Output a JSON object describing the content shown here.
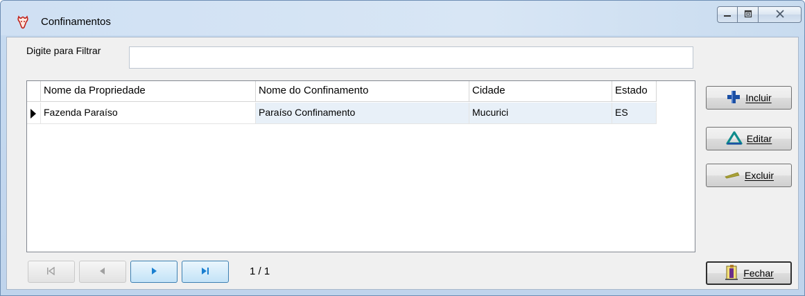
{
  "window": {
    "title": "Confinamentos",
    "controls": {
      "minimize_icon": "minimize-icon",
      "maximize_icon": "maximize-icon",
      "close_icon": "close-icon"
    }
  },
  "filter": {
    "label": "Digite para Filtrar",
    "value": "",
    "placeholder": ""
  },
  "grid": {
    "columns": [
      "Nome da Propriedade",
      "Nome do Confinamento",
      "Cidade",
      "Estado"
    ],
    "rows": [
      {
        "propriedade": "Fazenda Paraíso",
        "confinamento": "Paraíso Confinamento",
        "cidade": "Mucurici",
        "estado": "ES"
      }
    ]
  },
  "navigator": {
    "buttons": [
      {
        "name": "first",
        "icon": "first-record-icon",
        "enabled": false
      },
      {
        "name": "prior",
        "icon": "prior-record-icon",
        "enabled": false
      },
      {
        "name": "next",
        "icon": "next-record-icon",
        "enabled": true
      },
      {
        "name": "last",
        "icon": "last-record-icon",
        "enabled": true
      }
    ],
    "page_info": "1 / 1"
  },
  "actions": {
    "incluir": {
      "label": "Incluir",
      "icon": "plus-icon"
    },
    "editar": {
      "label": "Editar",
      "icon": "triangle-edit-icon"
    },
    "excluir": {
      "label": "Excluir",
      "icon": "minus-icon"
    },
    "fechar": {
      "label": "Fechar",
      "icon": "exit-door-icon"
    }
  },
  "colors": {
    "title_bar": "#cfe0f3",
    "selected_row": "#e8f0f8",
    "nav_active": "#1a7fd0",
    "plus_blue": "#1b4fa3",
    "edit_teal": "#0f8c8c",
    "minus_olive": "#a8a038"
  }
}
